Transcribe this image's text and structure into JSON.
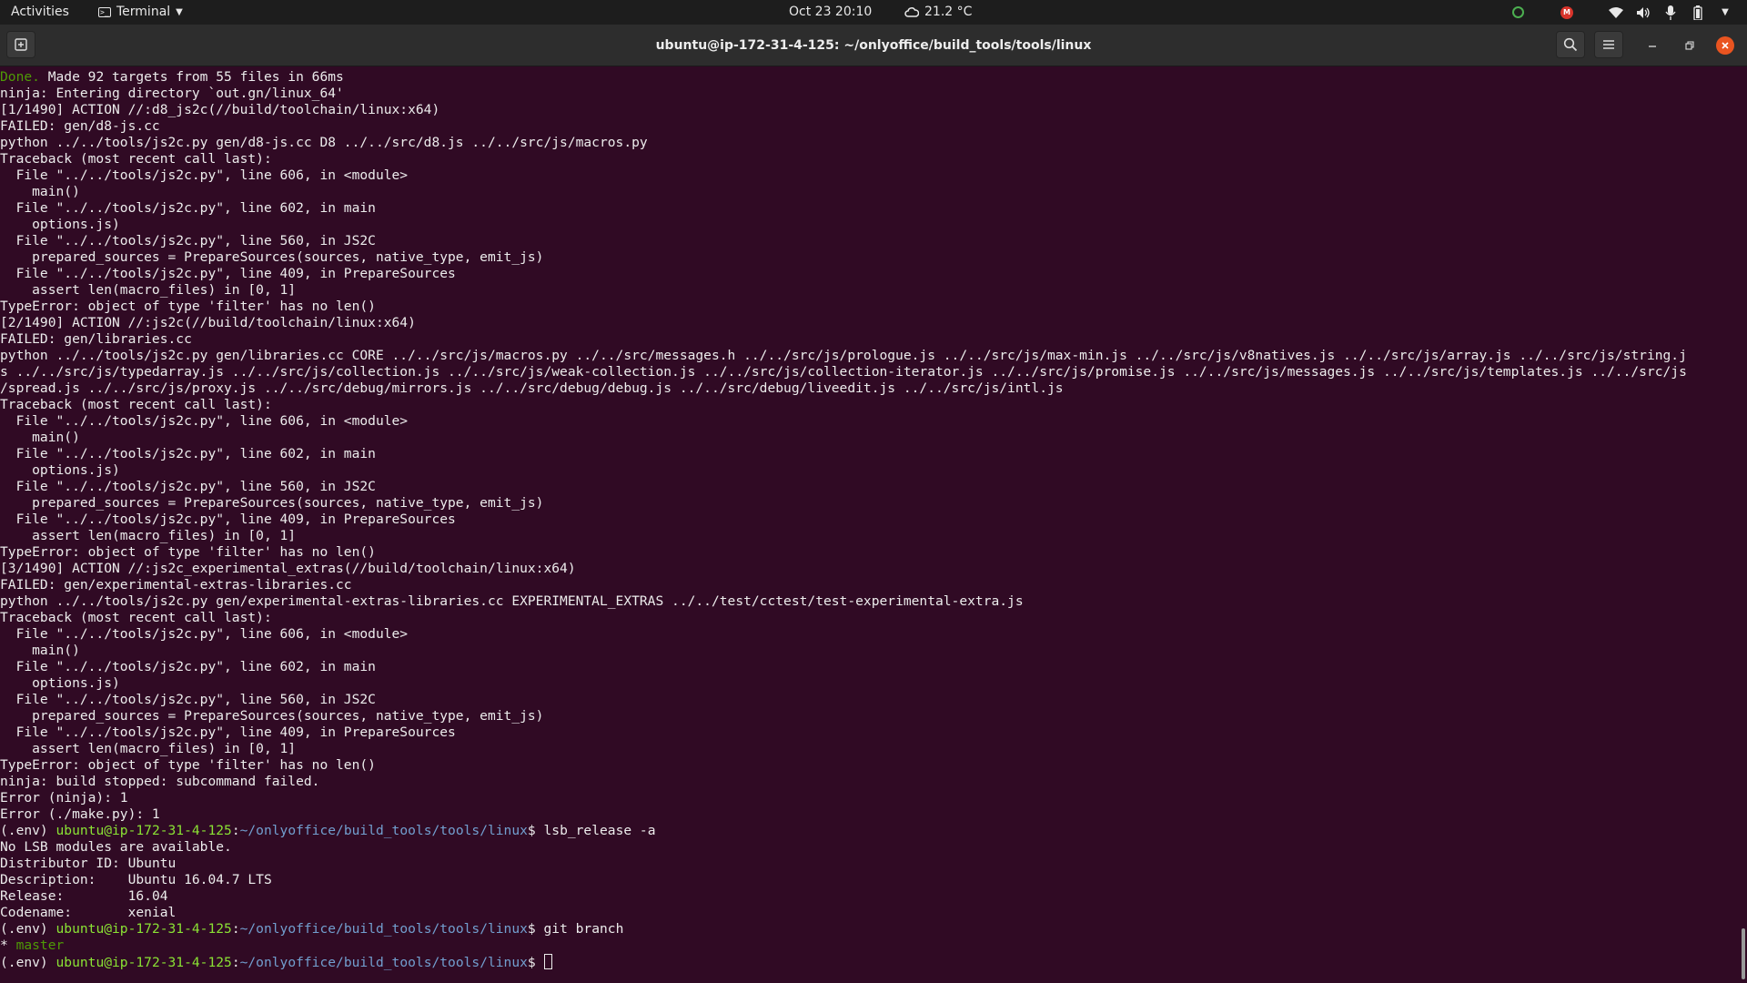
{
  "topbar": {
    "activities": "Activities",
    "app_menu": "Terminal",
    "clock": "Oct 23  20:10",
    "weather": "21.2 °C",
    "tray_icons": [
      "update-icon",
      "mail-badge-icon",
      "wifi-icon",
      "volume-icon",
      "microphone-icon",
      "battery-icon",
      "system-menu-caret-icon"
    ]
  },
  "window": {
    "title": "ubuntu@ip-172-31-4-125: ~/onlyoffice/build_tools/tools/linux",
    "header_icons": [
      "new-tab-icon",
      "search-icon",
      "hamburger-menu-icon",
      "minimize-icon",
      "maximize-icon",
      "close-icon"
    ]
  },
  "terminal": {
    "prompt": {
      "env": "(.env) ",
      "user_host": "ubuntu@ip-172-31-4-125",
      "path": "~/onlyoffice/build_tools/tools/linux",
      "suffix": "$ "
    },
    "lines": [
      {
        "done": "Done.",
        "text": " Made 92 targets from 55 files in 66ms"
      },
      {
        "text": "ninja: Entering directory `out.gn/linux_64'"
      },
      {
        "text": "[1/1490] ACTION //:d8_js2c(//build/toolchain/linux:x64)"
      },
      {
        "text": "FAILED: gen/d8-js.cc"
      },
      {
        "text": "python ../../tools/js2c.py gen/d8-js.cc D8 ../../src/d8.js ../../src/js/macros.py"
      },
      {
        "text": "Traceback (most recent call last):"
      },
      {
        "text": "  File \"../../tools/js2c.py\", line 606, in <module>"
      },
      {
        "text": "    main()"
      },
      {
        "text": "  File \"../../tools/js2c.py\", line 602, in main"
      },
      {
        "text": "    options.js)"
      },
      {
        "text": "  File \"../../tools/js2c.py\", line 560, in JS2C"
      },
      {
        "text": "    prepared_sources = PrepareSources(sources, native_type, emit_js)"
      },
      {
        "text": "  File \"../../tools/js2c.py\", line 409, in PrepareSources"
      },
      {
        "text": "    assert len(macro_files) in [0, 1]"
      },
      {
        "text": "TypeError: object of type 'filter' has no len()"
      },
      {
        "text": "[2/1490] ACTION //:js2c(//build/toolchain/linux:x64)"
      },
      {
        "text": "FAILED: gen/libraries.cc"
      },
      {
        "text": "python ../../tools/js2c.py gen/libraries.cc CORE ../../src/js/macros.py ../../src/messages.h ../../src/js/prologue.js ../../src/js/max-min.js ../../src/js/v8natives.js ../../src/js/array.js ../../src/js/string.j"
      },
      {
        "text": "s ../../src/js/typedarray.js ../../src/js/collection.js ../../src/js/weak-collection.js ../../src/js/collection-iterator.js ../../src/js/promise.js ../../src/js/messages.js ../../src/js/templates.js ../../src/js"
      },
      {
        "text": "/spread.js ../../src/js/proxy.js ../../src/debug/mirrors.js ../../src/debug/debug.js ../../src/debug/liveedit.js ../../src/js/intl.js"
      },
      {
        "text": "Traceback (most recent call last):"
      },
      {
        "text": "  File \"../../tools/js2c.py\", line 606, in <module>"
      },
      {
        "text": "    main()"
      },
      {
        "text": "  File \"../../tools/js2c.py\", line 602, in main"
      },
      {
        "text": "    options.js)"
      },
      {
        "text": "  File \"../../tools/js2c.py\", line 560, in JS2C"
      },
      {
        "text": "    prepared_sources = PrepareSources(sources, native_type, emit_js)"
      },
      {
        "text": "  File \"../../tools/js2c.py\", line 409, in PrepareSources"
      },
      {
        "text": "    assert len(macro_files) in [0, 1]"
      },
      {
        "text": "TypeError: object of type 'filter' has no len()"
      },
      {
        "text": "[3/1490] ACTION //:js2c_experimental_extras(//build/toolchain/linux:x64)"
      },
      {
        "text": "FAILED: gen/experimental-extras-libraries.cc"
      },
      {
        "text": "python ../../tools/js2c.py gen/experimental-extras-libraries.cc EXPERIMENTAL_EXTRAS ../../test/cctest/test-experimental-extra.js"
      },
      {
        "text": "Traceback (most recent call last):"
      },
      {
        "text": "  File \"../../tools/js2c.py\", line 606, in <module>"
      },
      {
        "text": "    main()"
      },
      {
        "text": "  File \"../../tools/js2c.py\", line 602, in main"
      },
      {
        "text": "    options.js)"
      },
      {
        "text": "  File \"../../tools/js2c.py\", line 560, in JS2C"
      },
      {
        "text": "    prepared_sources = PrepareSources(sources, native_type, emit_js)"
      },
      {
        "text": "  File \"../../tools/js2c.py\", line 409, in PrepareSources"
      },
      {
        "text": "    assert len(macro_files) in [0, 1]"
      },
      {
        "text": "TypeError: object of type 'filter' has no len()"
      },
      {
        "text": "ninja: build stopped: subcommand failed."
      },
      {
        "text": "Error (ninja): 1"
      },
      {
        "text": "Error (./make.py): 1"
      },
      {
        "prompt": true,
        "cmd": "lsb_release -a"
      },
      {
        "text": "No LSB modules are available."
      },
      {
        "text": "Distributor ID:\tUbuntu"
      },
      {
        "text": "Description:\tUbuntu 16.04.7 LTS"
      },
      {
        "text": "Release:\t16.04"
      },
      {
        "text": "Codename:\txenial"
      },
      {
        "prompt": true,
        "cmd": "git branch"
      },
      {
        "star": "* ",
        "branch": "master"
      },
      {
        "prompt": true,
        "cmd": "",
        "cursor": true
      }
    ]
  },
  "colors": {
    "terminal_bg": "#300a24",
    "prompt_user": "#8ae234",
    "prompt_path": "#729fcf",
    "close_button": "#e95420"
  }
}
